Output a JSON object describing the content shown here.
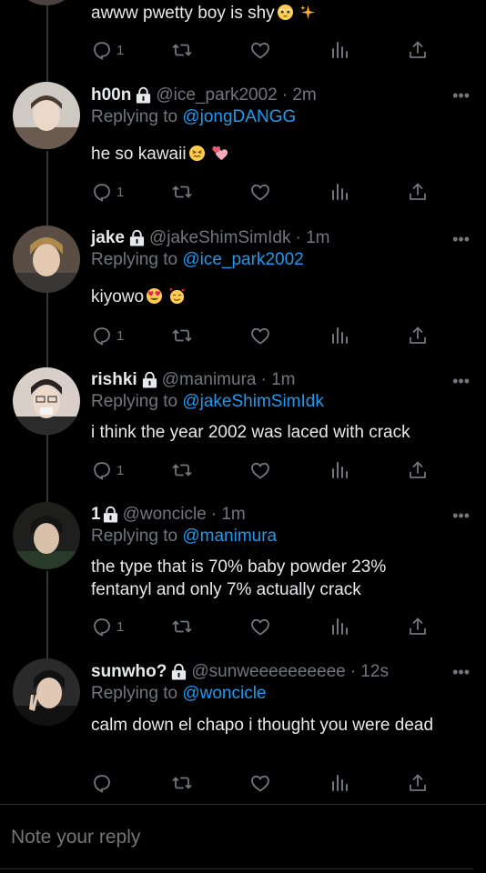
{
  "top_tweet": {
    "text": "awww pwetty boy is shy",
    "emojis": [
      "pleading-face-emoji",
      "sparkles-emoji"
    ],
    "reply_count": "1"
  },
  "tweets": [
    {
      "name": "h00n",
      "handle": "@ice_park2002",
      "time": "· 2m",
      "replying_prefix": "Replying to",
      "replying_to": "@jongDANGG",
      "text": "he so kawaii",
      "emojis": [
        "confounded-face-emoji",
        "two-hearts-emoji"
      ],
      "reply_count": "1"
    },
    {
      "name": "jake",
      "handle": "@jakeShimSimIdk",
      "time": "· 1m",
      "replying_prefix": "Replying to",
      "replying_to": "@ice_park2002",
      "text": "kiyowo",
      "emojis": [
        "heart-eyes-emoji",
        "smiling-face-with-hearts-emoji"
      ],
      "reply_count": "1"
    },
    {
      "name": "rishki",
      "handle": "@manimura",
      "time": "· 1m",
      "replying_prefix": "Replying to",
      "replying_to": "@jakeShimSimIdk",
      "text": "i think the year 2002 was laced with crack",
      "reply_count": "1"
    },
    {
      "name": "1",
      "handle": "@woncicle",
      "time": "· 1m",
      "replying_prefix": "Replying to",
      "replying_to": "@manimura",
      "text": "the type that is 70% baby powder 23% fentanyl and only 7% actually crack",
      "reply_count": "1"
    },
    {
      "name": "sunwho?",
      "handle": "@sunweeeeeeeeee",
      "time": "· 12s",
      "replying_prefix": "Replying to",
      "replying_to": "@woncicle",
      "text": "calm down el chapo i thought you were dead",
      "reply_count": ""
    }
  ],
  "composer": {
    "placeholder": "Note your reply"
  },
  "more_label": "•••",
  "colors": {
    "background": "#000000",
    "text": "#e7e9ea",
    "secondary": "#71767b",
    "link": "#1d9bf0",
    "divider": "#2f3336"
  }
}
